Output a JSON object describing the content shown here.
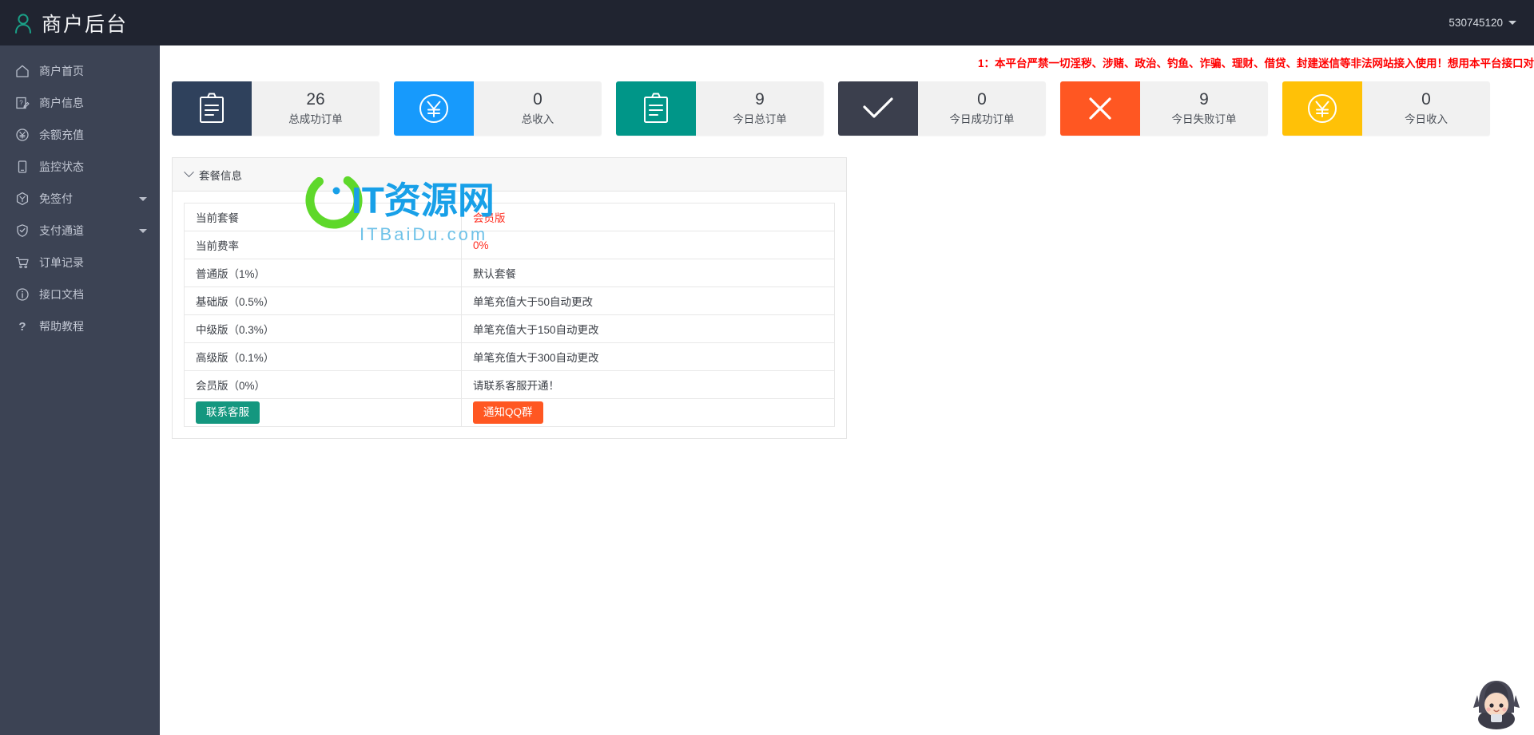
{
  "topbar": {
    "brand_icon": "user-icon",
    "title": "商户后台",
    "account": "530745120",
    "caret_icon": "chevron-down-icon"
  },
  "sidebar": {
    "items": [
      {
        "label": "商户首页",
        "icon": "home-icon",
        "arrow": false
      },
      {
        "label": "商户信息",
        "icon": "edit-profile-icon",
        "arrow": false
      },
      {
        "label": "余额充值",
        "icon": "yen-circle-icon",
        "arrow": false
      },
      {
        "label": "监控状态",
        "icon": "mobile-icon",
        "arrow": false
      },
      {
        "label": "免签付",
        "icon": "cube-icon",
        "arrow": true
      },
      {
        "label": "支付通道",
        "icon": "shield-check-icon",
        "arrow": true
      },
      {
        "label": "订单记录",
        "icon": "cart-icon",
        "arrow": false
      },
      {
        "label": "接口文档",
        "icon": "info-circle-icon",
        "arrow": false
      },
      {
        "label": "帮助教程",
        "icon": "question-mark-icon",
        "arrow": false
      }
    ]
  },
  "main": {
    "notice": "1：本平台严禁一切淫秽、涉赌、政治、钓鱼、诈骗、理财、借贷、封建迷信等非法网站接入使用！想用本平台接口对",
    "notice_color": "#ff0000",
    "cards": [
      {
        "value": "26",
        "label": "总成功订单",
        "icon": "clipboard-icon",
        "color": "#2f415c"
      },
      {
        "value": "0",
        "label": "总收入",
        "icon": "yen-circle-icon",
        "color": "#179afc"
      },
      {
        "value": "9",
        "label": "今日总订单",
        "icon": "clipboard-icon",
        "color": "#009688"
      },
      {
        "value": "0",
        "label": "今日成功订单",
        "icon": "check-icon",
        "color": "#3b3f4d"
      },
      {
        "value": "9",
        "label": "今日失败订单",
        "icon": "close-icon",
        "color": "#ff5722"
      },
      {
        "value": "0",
        "label": "今日收入",
        "icon": "yen-circle-icon",
        "color": "#ffc107"
      }
    ],
    "panel": {
      "title": "套餐信息",
      "rows": [
        {
          "key": "当前套餐",
          "value": "会员版",
          "red": true,
          "type": "text"
        },
        {
          "key": "当前费率",
          "value": "0%",
          "red": true,
          "type": "text"
        },
        {
          "key": "普通版（1%）",
          "value": "默认套餐",
          "red": false,
          "type": "text"
        },
        {
          "key": "基础版（0.5%）",
          "value": "单笔充值大于50自动更改",
          "red": false,
          "type": "text"
        },
        {
          "key": "中级版（0.3%）",
          "value": "单笔充值大于150自动更改",
          "red": false,
          "type": "text"
        },
        {
          "key": "高级版（0.1%）",
          "value": "单笔充值大于300自动更改",
          "red": false,
          "type": "text"
        },
        {
          "key": "会员版（0%）",
          "value": "请联系客服开通！",
          "red": false,
          "type": "text"
        }
      ],
      "actions": {
        "contact_label": "联系客服",
        "contact_color": "#14977f",
        "qq_label": "通知QQ群",
        "qq_color": "#ff5722"
      }
    },
    "watermark": {
      "brand": "IT资源网",
      "domain": "ITBaiDu.com"
    },
    "mascot_icon": "mascot-icon"
  }
}
